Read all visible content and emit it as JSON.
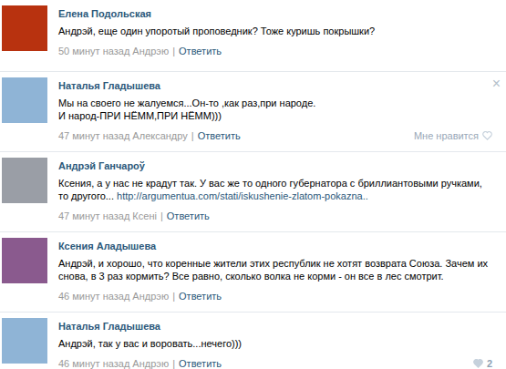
{
  "comments": [
    {
      "author": "Елена Подольская",
      "color": "#b8320f",
      "text": "Андрэй, еще один упоротый проповедник? Тоже куришь покрышки?",
      "time": "50 минут назад Андрэю",
      "separator": "|",
      "reply": "Ответить"
    },
    {
      "author": "Наталья Гладышева",
      "color": "#8fb4d6",
      "text": "Мы на своего не жалуемся...Он-то ,как раз,при народе.\nИ народ-ПРИ НЁММ,ПРИ НЁММ)))",
      "time": "47 минут назад Александру",
      "separator": "|",
      "reply": "Ответить",
      "like_label": "Мне нравится",
      "close": "×"
    },
    {
      "author": "Андрэй Ганчароў",
      "color": "#9a9ea6",
      "text": "Ксения, а у нас не крадут так. У вас же то одного губернатора с бриллиантовыми ручками, то другого... ",
      "link": "http://argumentua.com/stati/iskushenie-zlatom-pokazna..",
      "time": "47 минут назад Ксені",
      "separator": "|",
      "reply": "Ответить"
    },
    {
      "author": "Ксения Аладышева",
      "color": "#8a5a8e",
      "text": "Андрэй, и хорошо, что коренные жители этих республик не хотят возврата Союза. Зачем их снова, в 3 раз кормить? Все равно, сколько волка не корми - он все в лес смотрит.",
      "time": "46 минут назад Андрэю",
      "separator": "|",
      "reply": "Ответить"
    },
    {
      "author": "Наталья Гладышева",
      "color": "#8fb4d6",
      "text": "Андрэй, так у вас и воровать...нечего)))",
      "time": "46 минут назад Андрэю",
      "separator": "|",
      "reply": "Ответить",
      "like_count": "2"
    }
  ]
}
